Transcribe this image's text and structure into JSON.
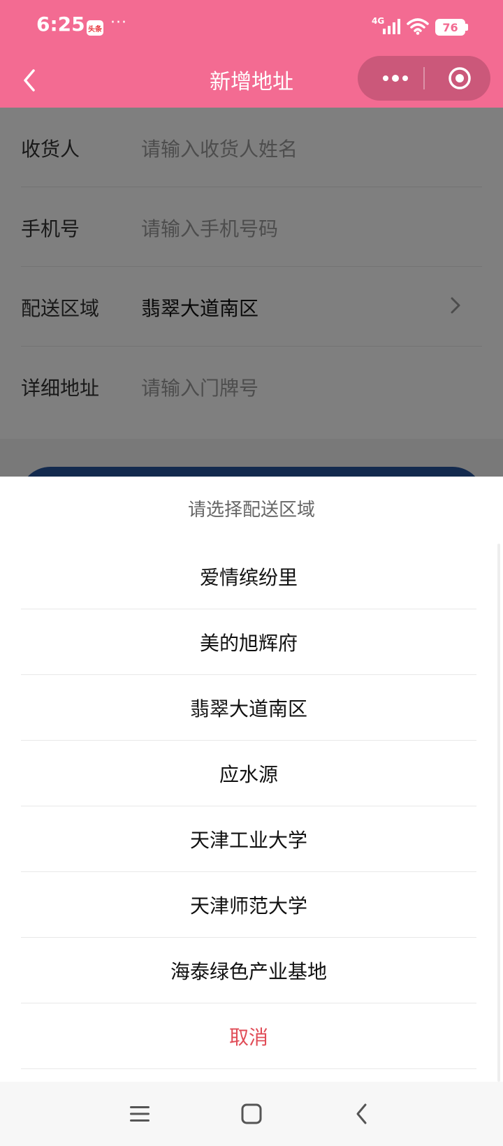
{
  "status_bar": {
    "time": "6:25",
    "app_badge": "头条",
    "more_dots": "···",
    "network": "4G",
    "battery": "76"
  },
  "header": {
    "title": "新增地址"
  },
  "form": {
    "rows": [
      {
        "label": "收货人",
        "placeholder": "请输入收货人姓名"
      },
      {
        "label": "手机号",
        "placeholder": "请输入手机号码"
      },
      {
        "label": "配送区域",
        "value": "翡翠大道南区"
      },
      {
        "label": "详细地址",
        "placeholder": "请输入门牌号"
      }
    ]
  },
  "sheet": {
    "title": "请选择配送区域",
    "options": [
      "爱情缤纷里",
      "美的旭辉府",
      "翡翠大道南区",
      "应水源",
      "天津工业大学",
      "天津师范大学",
      "海泰绿色产业基地"
    ],
    "cancel": "取消"
  },
  "colors": {
    "header_bg": "#f36b92",
    "submit_bg": "#27559c",
    "cancel_text": "#e04c57"
  },
  "icons": {
    "back": "chevron-left-icon",
    "more": "more-dots-icon",
    "close_miniapp": "target-icon",
    "row_arrow": "chevron-right-icon",
    "sys_menu": "menu-icon",
    "sys_home": "home-square-icon",
    "sys_back": "back-chevron-icon"
  }
}
